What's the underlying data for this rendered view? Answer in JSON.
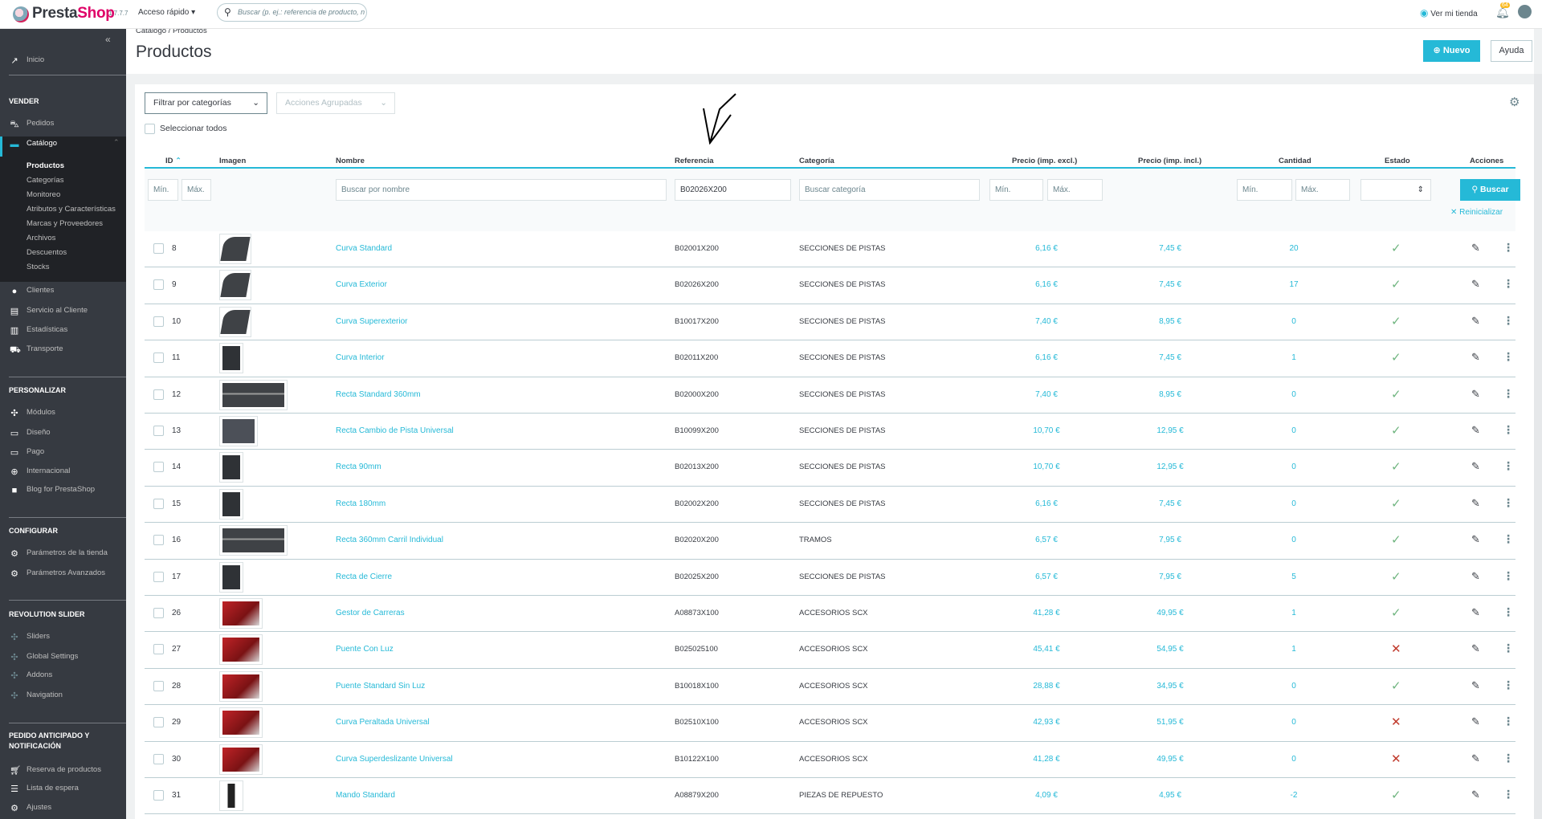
{
  "app": {
    "brand_a": "Presta",
    "brand_b": "Shop",
    "version": "1.7.7.7",
    "quick_access": "Acceso rápido",
    "search_placeholder": "Buscar (p. ej.: referencia de producto, n",
    "view_shop": "Ver mi tienda",
    "notifications_count": "64"
  },
  "sidebar": {
    "home": "Inicio",
    "sections": {
      "sell": "VENDER",
      "customize": "PERSONALIZAR",
      "configure": "CONFIGURAR",
      "revslider": "REVOLUTION SLIDER",
      "preorder": "PEDIDO ANTICIPADO Y NOTIFICACIÓN"
    },
    "sell_items": [
      "Pedidos",
      "Catálogo",
      "Clientes",
      "Servicio al Cliente",
      "Estadísticas",
      "Transporte"
    ],
    "catalog_sub": [
      "Productos",
      "Categorías",
      "Monitoreo",
      "Atributos y Características",
      "Marcas y Proveedores",
      "Archivos",
      "Descuentos",
      "Stocks"
    ],
    "customize_items": [
      "Módulos",
      "Diseño",
      "Pago",
      "Internacional",
      "Blog for PrestaShop"
    ],
    "configure_items": [
      "Parámetros de la tienda",
      "Parámetros Avanzados"
    ],
    "revslider_items": [
      "Sliders",
      "Global Settings",
      "Addons",
      "Navigation"
    ],
    "preorder_items": [
      "Reserva de productos",
      "Lista de espera",
      "Ajustes"
    ]
  },
  "page": {
    "breadcrumb": "Catálogo /  Productos",
    "title": "Productos",
    "new_button": "Nuevo",
    "help_button": "Ayuda"
  },
  "toolbar": {
    "filter_categories": "Filtrar por categorías",
    "bulk_actions": "Acciones Agrupadas",
    "select_all": "Seleccionar todos"
  },
  "columns": {
    "id": "ID",
    "image": "Imagen",
    "name": "Nombre",
    "reference": "Referencia",
    "category": "Categoría",
    "price_excl": "Precio (imp. excl.)",
    "price_incl": "Precio (imp. incl.)",
    "quantity": "Cantidad",
    "status": "Estado",
    "actions": "Acciones"
  },
  "filters": {
    "min": "Mín.",
    "max": "Máx.",
    "name_placeholder": "Buscar por nombre",
    "reference_value": "B02026X200",
    "category_placeholder": "Buscar categoría",
    "search_button": "Buscar",
    "reset": "Reinicializar"
  },
  "colors": {
    "accent": "#25b9d7",
    "sidebar": "#363a41",
    "active_ok": "#70b580",
    "inactive": "#c0392b"
  },
  "products": [
    {
      "id": "8",
      "thumb": "curve",
      "name": "Curva Standard",
      "ref": "B02001X200",
      "cat": "SECCIONES DE PISTAS",
      "pe": "6,16 €",
      "pi": "7,45 €",
      "q": "20",
      "active": true
    },
    {
      "id": "9",
      "thumb": "curve",
      "name": "Curva Exterior",
      "ref": "B02026X200",
      "cat": "SECCIONES DE PISTAS",
      "pe": "6,16 €",
      "pi": "7,45 €",
      "q": "17",
      "active": true
    },
    {
      "id": "10",
      "thumb": "curve",
      "name": "Curva Superexterior",
      "ref": "B10017X200",
      "cat": "SECCIONES DE PISTAS",
      "pe": "7,40 €",
      "pi": "8,95 €",
      "q": "0",
      "active": true
    },
    {
      "id": "11",
      "thumb": "narrow",
      "name": "Curva Interior",
      "ref": "B02011X200",
      "cat": "SECCIONES DE PISTAS",
      "pe": "6,16 €",
      "pi": "7,45 €",
      "q": "1",
      "active": true
    },
    {
      "id": "12",
      "thumb": "wide",
      "name": "Recta Standard 360mm",
      "ref": "B02000X200",
      "cat": "SECCIONES DE PISTAS",
      "pe": "7,40 €",
      "pi": "8,95 €",
      "q": "0",
      "active": true
    },
    {
      "id": "13",
      "thumb": "cross",
      "name": "Recta Cambio de Pista Universal",
      "ref": "B10099X200",
      "cat": "SECCIONES DE PISTAS",
      "pe": "10,70 €",
      "pi": "12,95 €",
      "q": "0",
      "active": true
    },
    {
      "id": "14",
      "thumb": "narrow",
      "name": "Recta 90mm",
      "ref": "B02013X200",
      "cat": "SECCIONES DE PISTAS",
      "pe": "10,70 €",
      "pi": "12,95 €",
      "q": "0",
      "active": true
    },
    {
      "id": "15",
      "thumb": "narrow",
      "name": "Recta 180mm",
      "ref": "B02002X200",
      "cat": "SECCIONES DE PISTAS",
      "pe": "6,16 €",
      "pi": "7,45 €",
      "q": "0",
      "active": true
    },
    {
      "id": "16",
      "thumb": "wide",
      "name": "Recta 360mm Carril Individual",
      "ref": "B02020X200",
      "cat": "TRAMOS",
      "pe": "6,57 €",
      "pi": "7,95 €",
      "q": "0",
      "active": true
    },
    {
      "id": "17",
      "thumb": "narrow",
      "name": "Recta de Cierre",
      "ref": "B02025X200",
      "cat": "SECCIONES DE PISTAS",
      "pe": "6,57 €",
      "pi": "7,95 €",
      "q": "5",
      "active": true
    },
    {
      "id": "26",
      "thumb": "box",
      "name": "Gestor de Carreras",
      "ref": "A08873X100",
      "cat": "ACCESORIOS SCX",
      "pe": "41,28 €",
      "pi": "49,95 €",
      "q": "1",
      "active": true
    },
    {
      "id": "27",
      "thumb": "box",
      "name": "Puente Con Luz",
      "ref": "B025025100",
      "cat": "ACCESORIOS SCX",
      "pe": "45,41 €",
      "pi": "54,95 €",
      "q": "1",
      "active": false
    },
    {
      "id": "28",
      "thumb": "box",
      "name": "Puente Standard Sin Luz",
      "ref": "B10018X100",
      "cat": "ACCESORIOS SCX",
      "pe": "28,88 €",
      "pi": "34,95 €",
      "q": "0",
      "active": true
    },
    {
      "id": "29",
      "thumb": "box",
      "name": "Curva Peraltada Universal",
      "ref": "B02510X100",
      "cat": "ACCESORIOS SCX",
      "pe": "42,93 €",
      "pi": "51,95 €",
      "q": "0",
      "active": false
    },
    {
      "id": "30",
      "thumb": "box",
      "name": "Curva Superdeslizante Universal",
      "ref": "B10122X100",
      "cat": "ACCESORIOS SCX",
      "pe": "41,28 €",
      "pi": "49,95 €",
      "q": "0",
      "active": false
    },
    {
      "id": "31",
      "thumb": "ctrl",
      "name": "Mando Standard",
      "ref": "A08879X200",
      "cat": "PIEZAS DE REPUESTO",
      "pe": "4,09 €",
      "pi": "4,95 €",
      "q": "-2",
      "active": true
    }
  ]
}
